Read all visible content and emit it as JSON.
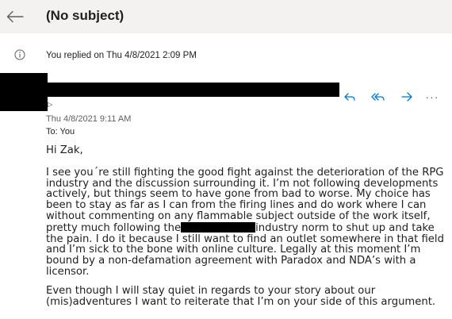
{
  "header": {
    "subject": "(No subject)",
    "back_icon": "arrow-left-icon"
  },
  "notice": {
    "icon": "info-icon",
    "text": "You replied on Thu 4/8/2021 2:09 PM"
  },
  "message": {
    "date": "Thu 4/8/2021 9:11 AM",
    "to_label": "To:",
    "to_value": "You",
    "actions": {
      "reply_icon": "reply-icon",
      "reply_all_icon": "reply-all-icon",
      "forward_icon": "forward-icon",
      "more_label": "···"
    },
    "colors": {
      "accent": "#0078d4",
      "header_bg": "#f3f2f1"
    },
    "body": {
      "greeting": "Hi Zak,",
      "p1": [
        "I see you´re still fighting the good fight against the deterioration of the RPG",
        "industry and the discussion surrounding it. I’m not following developments",
        "actively, but things seem to have gone from bad to worse. My choice has",
        "been to stay as far as I can from the firing lines and do work where I can",
        "without commenting on any flammable subject outside of the work itself,",
        "the pain. I do it because I still want to find an outlet somewhere in that field",
        "and I’m sick to the bone with online culture. Legally at this moment I’m",
        "bound by a non-defamation agreement with Paradox and NDA’s with a",
        "licensor."
      ],
      "p1_redacted_before": "pretty much following the",
      "p1_redacted_after": "industry norm to shut up and take",
      "p2": [
        "Even though I will stay quiet in regards to your story about our",
        "(mis)adventures I want to reiterate that I’m on your side of this argument."
      ]
    }
  }
}
